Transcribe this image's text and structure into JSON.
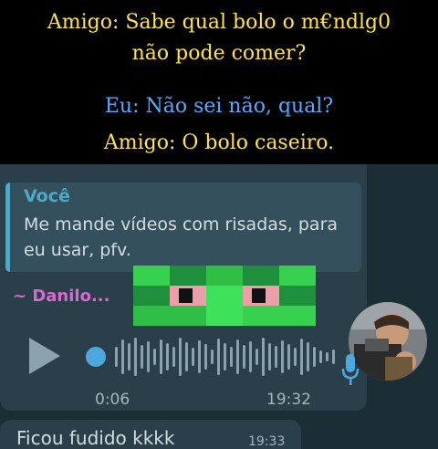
{
  "caption": {
    "line1": "Amigo: Sabe qual bolo o m€ndlg0",
    "line2": "não pode comer?",
    "line3": "Eu: Não sei não, qual?",
    "line4": "Amigo: O bolo caseiro."
  },
  "voice_message": {
    "reply": {
      "name": "Você",
      "text": "Me mande vídeos com risadas, para eu usar, pfv."
    },
    "sender": "~ Danilo...",
    "duration": "0:06",
    "time": "19:32"
  },
  "next_message": {
    "text": "Ficou fudido kkkk",
    "time": "19:33"
  },
  "colors": {
    "caption_yellow": "#ffe34a",
    "caption_blue": "#5aa8ff",
    "chat_bg": "#1b2d35",
    "bubble": "#2a3f49",
    "accent": "#4ea8c7",
    "sender": "#d36bd0"
  },
  "icons": [
    "play-icon",
    "microphone-icon"
  ]
}
